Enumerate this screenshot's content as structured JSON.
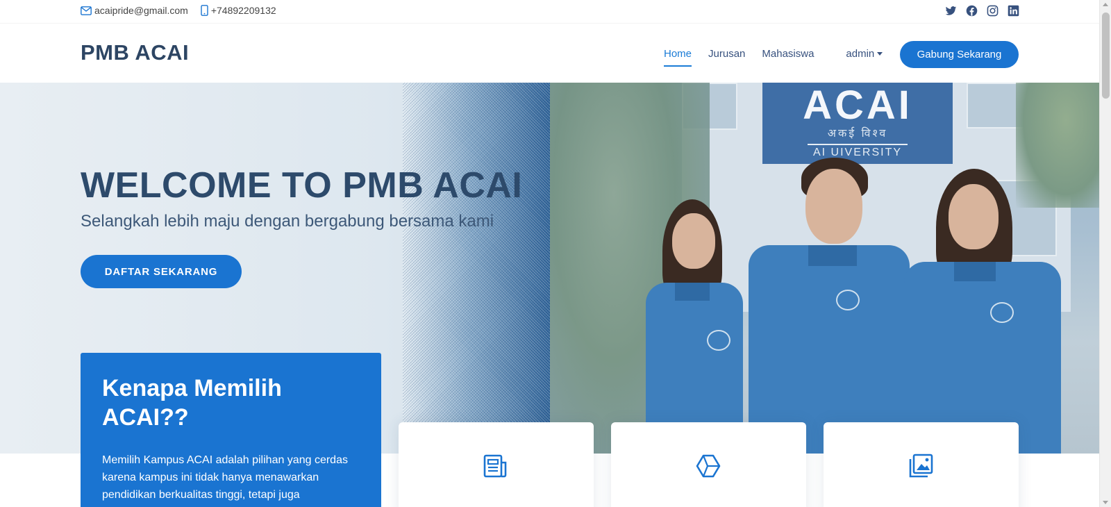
{
  "topbar": {
    "email": "acaipride@gmail.com",
    "phone": "+74892209132",
    "social": [
      "twitter-icon",
      "facebook-icon",
      "instagram-icon",
      "linkedin-icon"
    ]
  },
  "header": {
    "logo": "PMB ACAI",
    "nav": {
      "home": "Home",
      "jurusan": "Jurusan",
      "mahasiswa": "Mahasiswa",
      "admin": "admin"
    },
    "cta": "Gabung Sekarang"
  },
  "hero": {
    "title": "WELCOME TO PMB ACAI",
    "subtitle": "Selangkah lebih maju dengan bergabung bersama kami",
    "button": "DAFTAR SEKARANG",
    "sign": {
      "name": "ACAI",
      "script": "अकई विश्व",
      "university": "AI UIVERSITY"
    }
  },
  "why": {
    "title": "Kenapa Memilih ACAI??",
    "body": "Memilih Kampus ACAI adalah pilihan yang cerdas karena kampus ini tidak hanya menawarkan pendidikan berkualitas tinggi, tetapi juga"
  },
  "cards": [
    {
      "icon": "document-icon"
    },
    {
      "icon": "cube-icon"
    },
    {
      "icon": "images-icon"
    }
  ],
  "colors": {
    "accent": "#1a74d1",
    "heading": "#2d4a6b"
  }
}
